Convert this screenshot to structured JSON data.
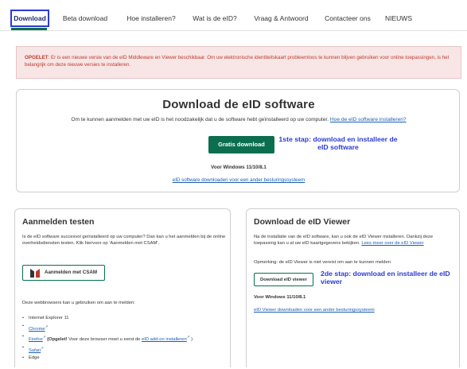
{
  "tabs": [
    {
      "label": "Download",
      "active": true
    },
    {
      "label": "Beta download"
    },
    {
      "label": "Hoe installeren?"
    },
    {
      "label": "Wat is de eID?"
    },
    {
      "label": "Vraag & Antwoord"
    },
    {
      "label": "Contacteer ons"
    },
    {
      "label": "NIEUWS"
    }
  ],
  "alert": {
    "prefix": "OPGELET",
    "text": ": Er is een nieuwe versie van de eID Middleware en Viewer beschikbaar. Om uw elektronische identiteitskaart probleemloos te kunnen blijven gebruiken voor online toepassingen, is het belangrijk om deze nieuwe versies te installeren."
  },
  "main": {
    "title": "Download de eID software",
    "subtitle": "Om te kunnen aanmelden met uw eID is het noodzakelijk dat u de software hebt geïnstalleerd op uw computer.",
    "subtitle_link": "Hoe de eID software installeren?",
    "button": "Gratis download",
    "step_note": "1ste stap: download en installeer de eID software",
    "windows_note": "Voor Windows 11/10/8.1",
    "other_os_link": "eID software downloaden voor een ander besturingssysteem"
  },
  "login": {
    "title": "Aanmelden testen",
    "text": "Is de eID software succesvol geïnstalleerd op uw computer? Dan kan u het aanmelden bij de online overheidsdiensten testen. Klik hiervoor op 'Aanmelden met CSAM'.",
    "button": "Aanmelden met CSAM",
    "browsers_intro": "Deze webbrowsers kan u gebruiken om aan te melden:",
    "browsers": {
      "ie": "Internet Explorer 11",
      "chrome": "Chrome",
      "firefox": "Firefox",
      "firefox_note_bold": "(Opgelet!",
      "firefox_note": " Voor deze browser moet u eerst de ",
      "firefox_link": "eID add-on installeren",
      "firefox_close": " )",
      "safari": "Safari",
      "edge": "Edge"
    }
  },
  "viewer": {
    "title": "Download de eID Viewer",
    "text": "Na de installatie van de eID software, kan u ook de eID Viewer installeren. Dankzij deze toepassing kan u al uw eID kaartgegevens bekijken.",
    "more_link": "Lees meer over de eID Viewer",
    "remark": "Opmerking: de eID Viewer is niet vereist om aan te kunnen melden",
    "button": "Download eID viewer",
    "step_note": "2de stap: download en installeer de eID viewer",
    "windows_note": "Voor Windows 11/10/8.1",
    "other_os_link": "eID Viewer downloaden voor een ander besturingssysteem"
  },
  "icons": {
    "external": "external-link-icon",
    "csam": "csam-logo-icon"
  },
  "colors": {
    "primary_green": "#0b6e4f",
    "annotation_blue": "#2b3bd6",
    "alert_red": "#c0392b",
    "link_blue": "#1a5db4"
  }
}
